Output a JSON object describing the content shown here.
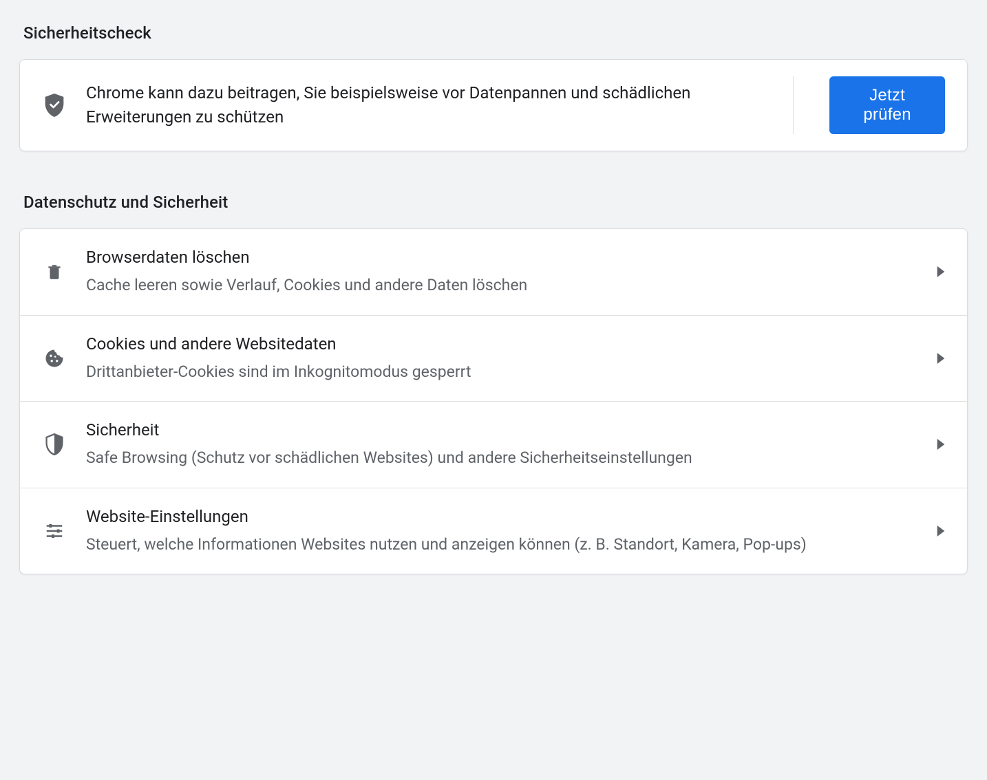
{
  "safety_check": {
    "title": "Sicherheitscheck",
    "description": "Chrome kann dazu beitragen, Sie beispielsweise vor Datenpannen und schädlichen Erweiterungen zu schützen",
    "button_label": "Jetzt prüfen"
  },
  "privacy": {
    "title": "Datenschutz und Sicherheit",
    "items": [
      {
        "icon": "trash-icon",
        "title": "Browserdaten löschen",
        "subtitle": "Cache leeren sowie Verlauf, Cookies und andere Daten löschen"
      },
      {
        "icon": "cookie-icon",
        "title": "Cookies und andere Websitedaten",
        "subtitle": "Drittanbieter-Cookies sind im Inkognitomodus gesperrt"
      },
      {
        "icon": "shield-icon",
        "title": "Sicherheit",
        "subtitle": "Safe Browsing (Schutz vor schädlichen Websites) und andere Sicherheitseinstellungen"
      },
      {
        "icon": "tune-icon",
        "title": "Website-Einstellungen",
        "subtitle": "Steuert, welche Informationen Websites nutzen und anzeigen können (z. B. Standort, Kamera, Pop-ups)"
      }
    ]
  }
}
